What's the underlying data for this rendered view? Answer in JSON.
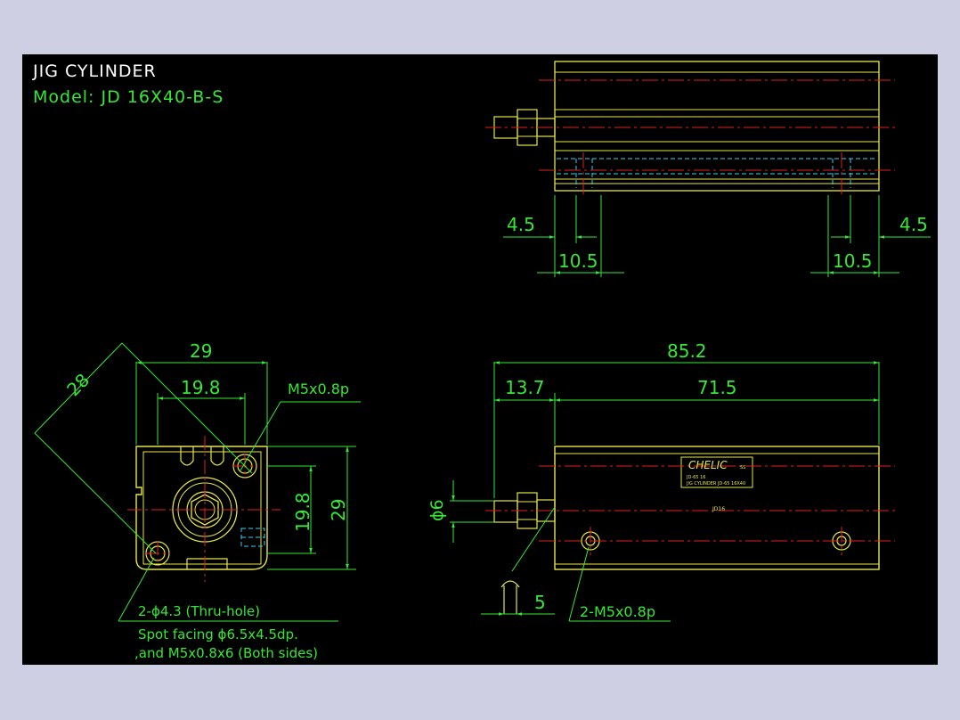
{
  "drawing": {
    "title": "JIG CYLINDER",
    "model": "Model:  JD 16X40-B-S"
  },
  "dims": {
    "top_left_offset": "4.5",
    "top_right_offset": "4.5",
    "top_left_width": "10.5",
    "top_right_width": "10.5",
    "front_width": "29",
    "front_inner_width": "19.8",
    "front_diag": "28",
    "front_port": "M5x0.8p",
    "front_height_inner": "19.8",
    "front_height": "29",
    "side_total": "85.2",
    "side_rod": "13.7",
    "side_body": "71.5",
    "side_rod_dia": "ϕ6",
    "side_thread": "5",
    "side_port": "2-M5x0.8p"
  },
  "notes": {
    "hole": "2-ϕ4.3 (Thru-hole)",
    "spot_facing": "Spot facing ϕ6.5x4.5dp.",
    "thread": ",and M5x0.8x6 (Both sides)"
  },
  "label_plate": {
    "brand": "CHELIC",
    "suffix": "SS",
    "line1": "JD-65 16",
    "line2": "JIG CYLINDER JD-65 16X40",
    "body_mark": "JD16"
  },
  "colors": {
    "background": "#000000",
    "outline": "#e6e64a",
    "dimension": "#35e835",
    "centerline": "#e02020",
    "hidden": "#3ad0f0",
    "text_white": "#ffffff"
  }
}
